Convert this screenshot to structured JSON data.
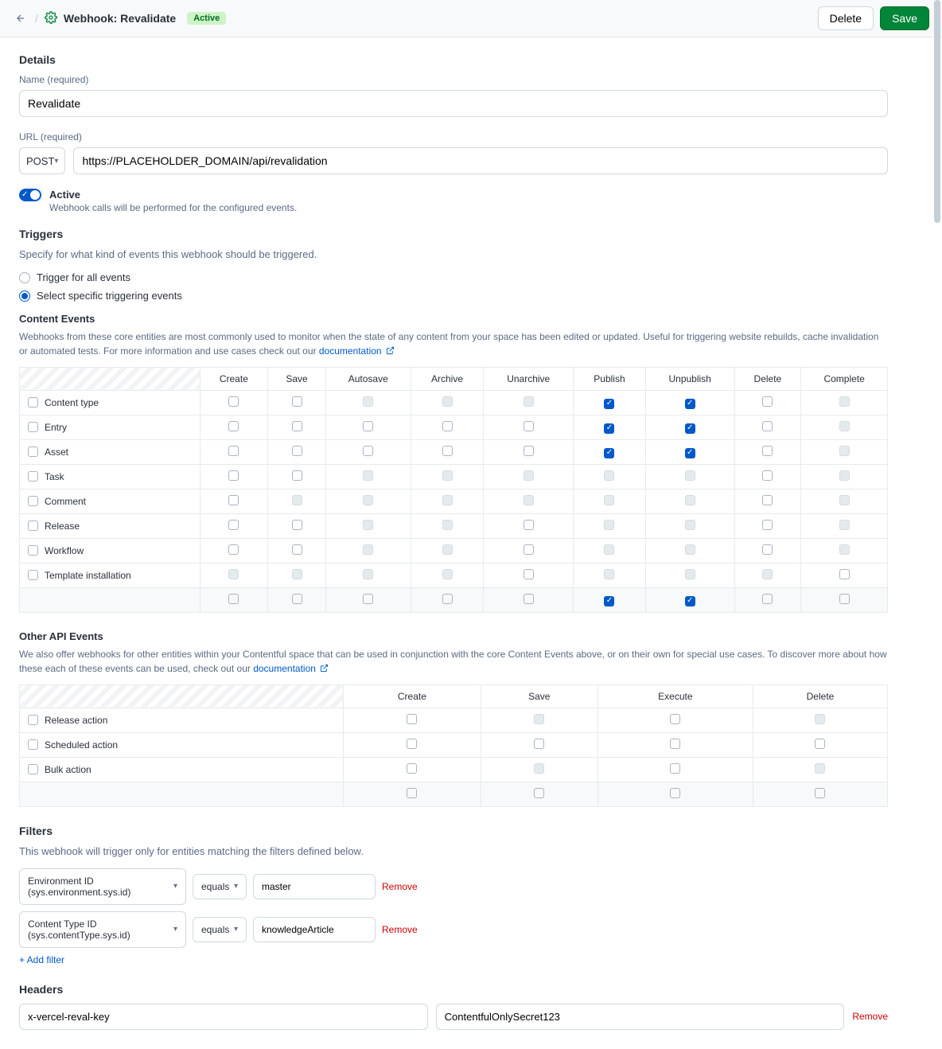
{
  "header": {
    "title": "Webhook: Revalidate",
    "badge": "Active",
    "delete": "Delete",
    "save": "Save"
  },
  "details": {
    "section": "Details",
    "name_label": "Name",
    "required": "(required)",
    "name_value": "Revalidate",
    "url_label": "URL",
    "method": "POST",
    "url_value": "https://PLACEHOLDER_DOMAIN/api/revalidation",
    "active_label": "Active",
    "active_desc": "Webhook calls will be performed for the configured events."
  },
  "triggers": {
    "section": "Triggers",
    "desc": "Specify for what kind of events this webhook should be triggered.",
    "opt_all": "Trigger for all events",
    "opt_specific": "Select specific triggering events"
  },
  "content_events": {
    "title": "Content Events",
    "desc": "Webhooks from these core entities are most commonly used to monitor when the state of any content from your space has been edited or updated. Useful for triggering website rebuilds, cache invalidation or automated tests. For more information and use cases check out our ",
    "doc": "documentation",
    "cols": [
      "Create",
      "Save",
      "Autosave",
      "Archive",
      "Unarchive",
      "Publish",
      "Unpublish",
      "Delete",
      "Complete"
    ],
    "rows": [
      {
        "label": "Content type",
        "cells": [
          "",
          "",
          "d",
          "d",
          "d",
          "c",
          "c",
          "",
          "d"
        ]
      },
      {
        "label": "Entry",
        "cells": [
          "",
          "",
          "",
          "",
          "",
          "c",
          "c",
          "",
          "d"
        ]
      },
      {
        "label": "Asset",
        "cells": [
          "",
          "",
          "",
          "",
          "",
          "c",
          "c",
          "",
          "d"
        ]
      },
      {
        "label": "Task",
        "cells": [
          "",
          "",
          "d",
          "d",
          "d",
          "d",
          "d",
          "",
          "d"
        ]
      },
      {
        "label": "Comment",
        "cells": [
          "",
          "d",
          "d",
          "d",
          "d",
          "d",
          "d",
          "",
          "d"
        ]
      },
      {
        "label": "Release",
        "cells": [
          "",
          "",
          "d",
          "d",
          "",
          "d",
          "d",
          "",
          "d"
        ]
      },
      {
        "label": "Workflow",
        "cells": [
          "",
          "",
          "d",
          "d",
          "",
          "d",
          "d",
          "",
          "d"
        ]
      },
      {
        "label": "Template installation",
        "cells": [
          "d",
          "d",
          "d",
          "d",
          "",
          "d",
          "d",
          "d",
          ""
        ]
      },
      {
        "label": "",
        "cells": [
          "",
          "",
          "",
          "",
          "",
          "c",
          "c",
          "",
          ""
        ]
      }
    ]
  },
  "other_events": {
    "title": "Other API Events",
    "desc": "We also offer webhooks for other entities within your Contentful space that can be used in conjunction with the core Content Events above, or on their own for special use cases. To discover more about how these each of these events can be used, check out our ",
    "doc": "documentation",
    "cols": [
      "Create",
      "Save",
      "Execute",
      "Delete"
    ],
    "rows": [
      {
        "label": "Release action",
        "cells": [
          "",
          "d",
          "",
          "d"
        ]
      },
      {
        "label": "Scheduled action",
        "cells": [
          "",
          "",
          "",
          ""
        ]
      },
      {
        "label": "Bulk action",
        "cells": [
          "",
          "d",
          "",
          "d"
        ]
      },
      {
        "label": "",
        "cells": [
          "",
          "",
          "",
          ""
        ]
      }
    ]
  },
  "filters": {
    "section": "Filters",
    "desc": "This webhook will trigger only for entities matching the filters defined below.",
    "items": [
      {
        "field": "Environment ID (sys.environment.sys.id)",
        "op": "equals",
        "val": "master"
      },
      {
        "field": "Content Type ID (sys.contentType.sys.id)",
        "op": "equals",
        "val": "knowledgeArticle"
      }
    ],
    "remove": "Remove",
    "add": "+ Add filter"
  },
  "headers": {
    "section": "Headers",
    "key": "x-vercel-reval-key",
    "val": "ContentfulOnlySecret123",
    "remove": "Remove"
  }
}
